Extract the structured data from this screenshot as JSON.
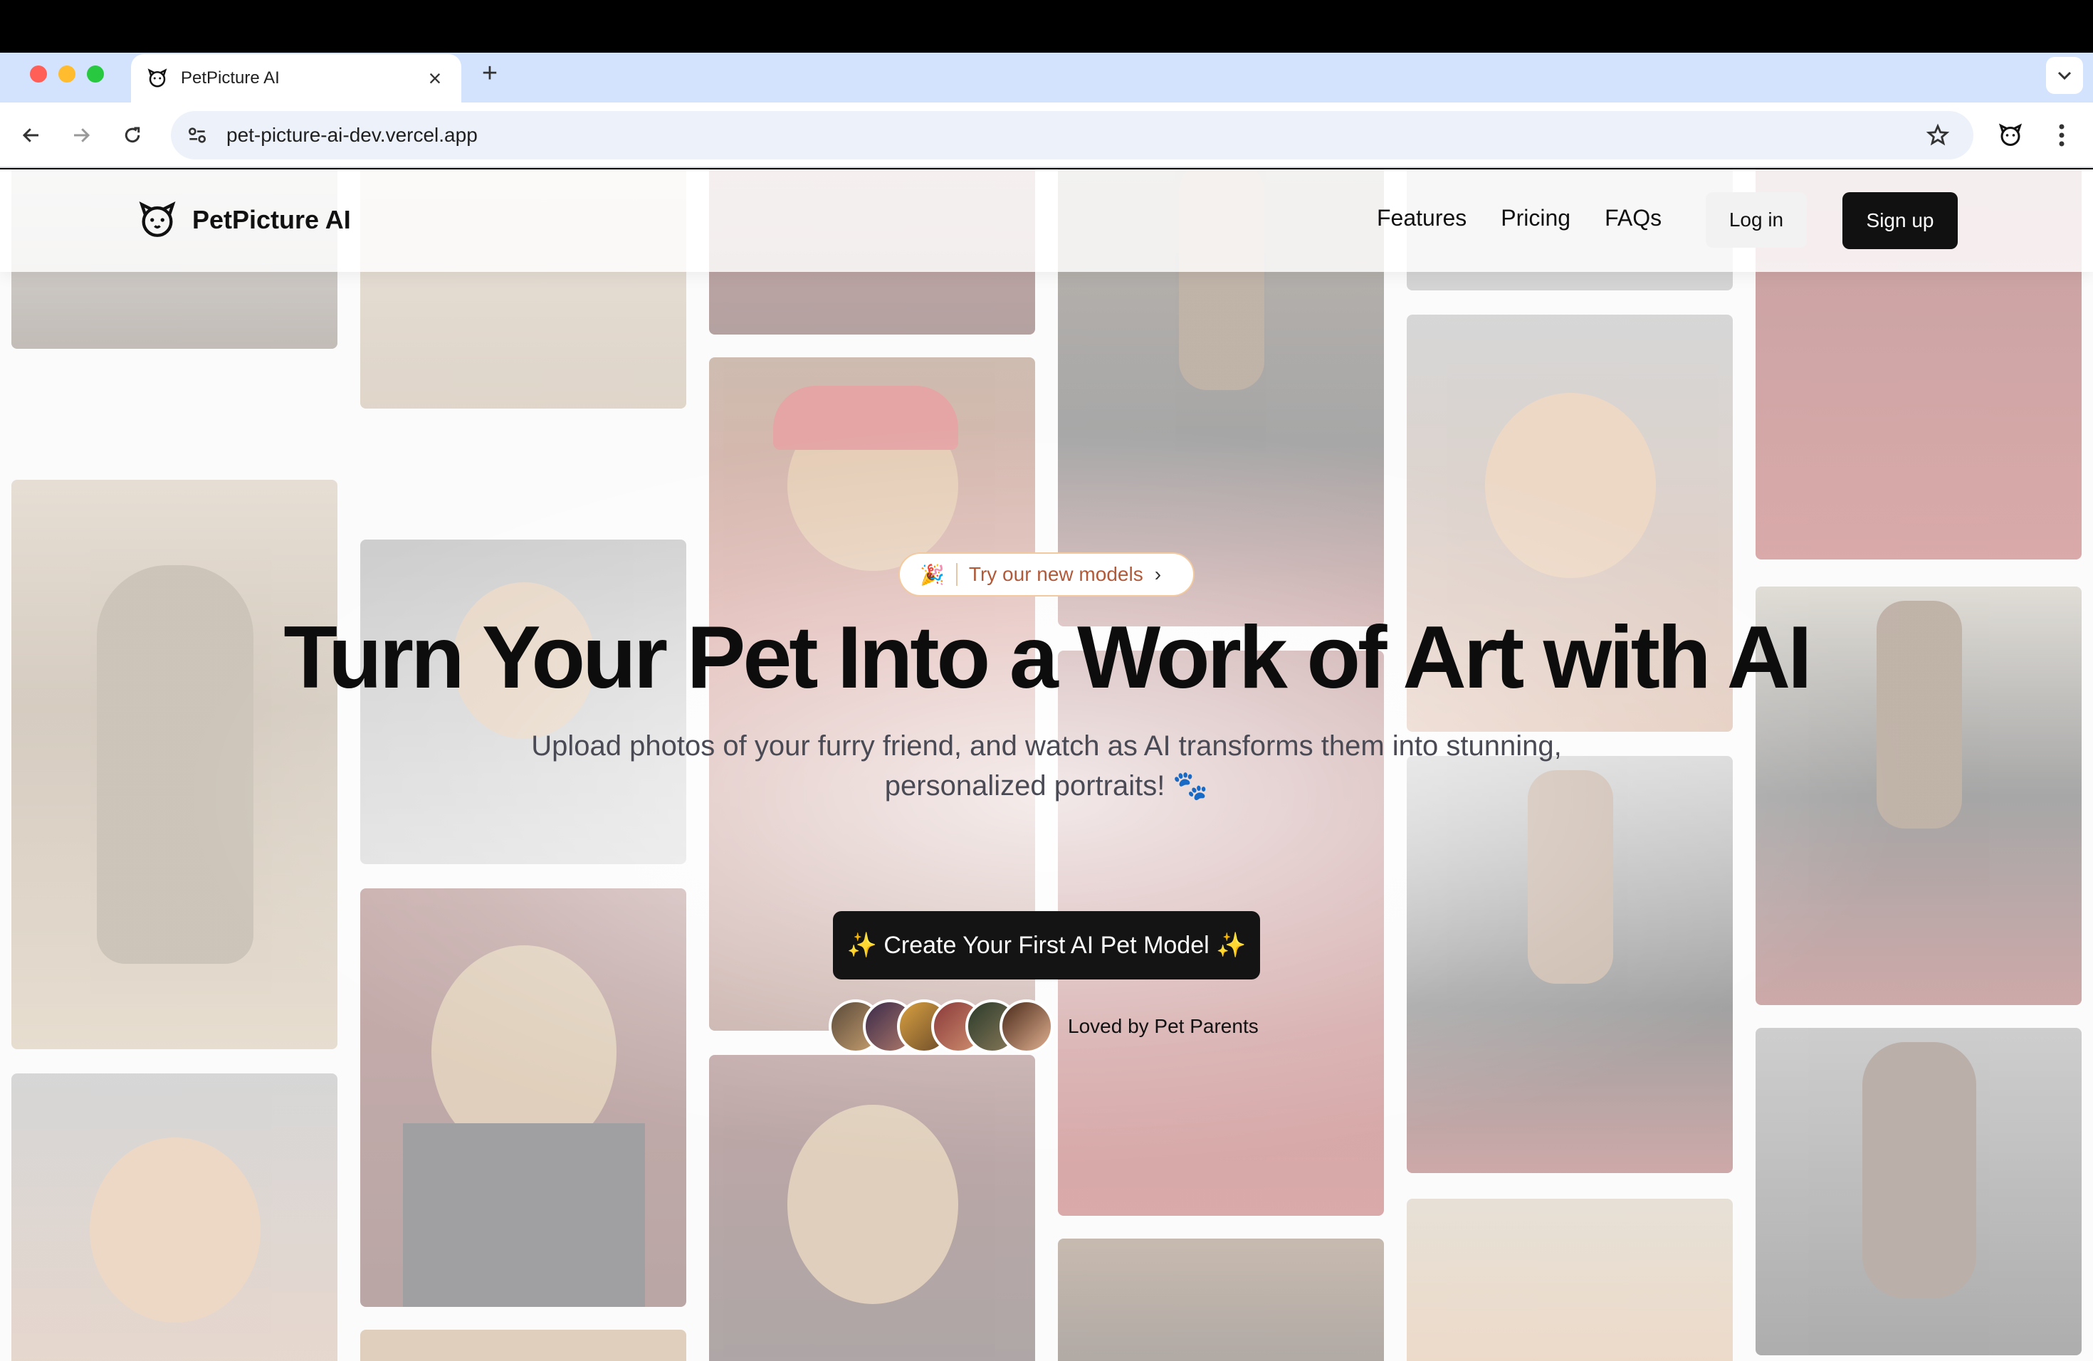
{
  "browser": {
    "tab_title": "PetPicture AI",
    "url": "pet-picture-ai-dev.vercel.app"
  },
  "site": {
    "brand": "PetPicture AI",
    "nav": [
      "Features",
      "Pricing",
      "FAQs"
    ],
    "login_label": "Log in",
    "signup_label": "Sign up"
  },
  "hero": {
    "pill_emoji": "🎉",
    "pill_text": "Try our new models",
    "headline": "Turn Your Pet Into a Work of Art with AI",
    "subtitle_line1": "Upload photos of your furry friend, and watch as AI transforms them into stunning,",
    "subtitle_line2": "personalized portraits! 🐾",
    "social_proof": "Loved by Pet Parents",
    "cta_label": "✨ Create Your First AI Pet Model ✨"
  },
  "colors": {
    "accent": "#111111",
    "pill_text": "#b15a3a",
    "pill_border": "#f3c9a0"
  },
  "icons": [
    "back-icon",
    "forward-icon",
    "reload-icon",
    "site-settings-icon",
    "bookmark-star-icon",
    "extension-icon",
    "kebab-menu-icon",
    "tab-list-icon",
    "paw-logo-icon"
  ]
}
